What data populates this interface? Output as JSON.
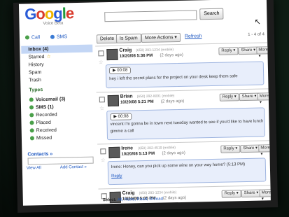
{
  "header": {
    "logo_letters": [
      "G",
      "o",
      "o",
      "g",
      "l",
      "e"
    ],
    "logo_sub": "Voice",
    "logo_sub2": "Beta",
    "search_button": "Search"
  },
  "sidebar": {
    "call_label": "Call",
    "sms_label": "SMS",
    "nav": [
      "Inbox (4)",
      "Starred",
      "History",
      "Spam",
      "Trash"
    ],
    "types_heading": "Types",
    "types": [
      "Voicemail (3)",
      "SMS (1)",
      "Recorded",
      "Placed",
      "Received",
      "Missed"
    ],
    "contacts_heading": "Contacts »",
    "view_all": "View All",
    "add_contact": "Add Contact »"
  },
  "toolbar": {
    "delete": "Delete",
    "spam": "Is Spam",
    "more_actions": "More Actions ▾",
    "refresh": "Refresh",
    "pager": "1 - 4 of 4"
  },
  "messages": [
    {
      "name": "Craig",
      "number": "(650) 283-1234 (mobile)",
      "time": "10/20/08 5:36 PM",
      "ago": "(2 days ago)",
      "player": "▶ 00:08",
      "transcript": "hey i left the secret plans for the project on your desk keep them safe"
    },
    {
      "name": "Brian",
      "number": "(650) 292-8091 (mobile)",
      "time": "10/20/08 5:21 PM",
      "ago": "(2 days ago)",
      "player": "▶ 00:08",
      "transcript": "vincent i'm gonna be in town next tuesday wanted to see if you'd like to have lunch",
      "transcript2": "gimme a call"
    },
    {
      "name": "Irene",
      "number": "(650) 282-4519 (mobile)",
      "time": "10/20/08 5:13 PM",
      "ago": "(2 days ago)",
      "transcript": "Irene: Honey, can you pick up some wine on your way home? (5:13 PM)",
      "reply": "Reply"
    },
    {
      "name": "Craig",
      "number": "(650) 283-1234 (mobile)",
      "time": "10/20/08 5:05 PM",
      "ago": "(2 days ago)"
    }
  ],
  "row_buttons": {
    "reply": "Reply ▾",
    "share": "Share ▾",
    "more": "More ▾"
  },
  "footer": {
    "select": "Select:",
    "links": "All, None, Read, Unread"
  },
  "colors": {
    "accent": "#1a55c0",
    "bubble": "#e8eefb",
    "selected_nav": "#c3d6f5"
  }
}
